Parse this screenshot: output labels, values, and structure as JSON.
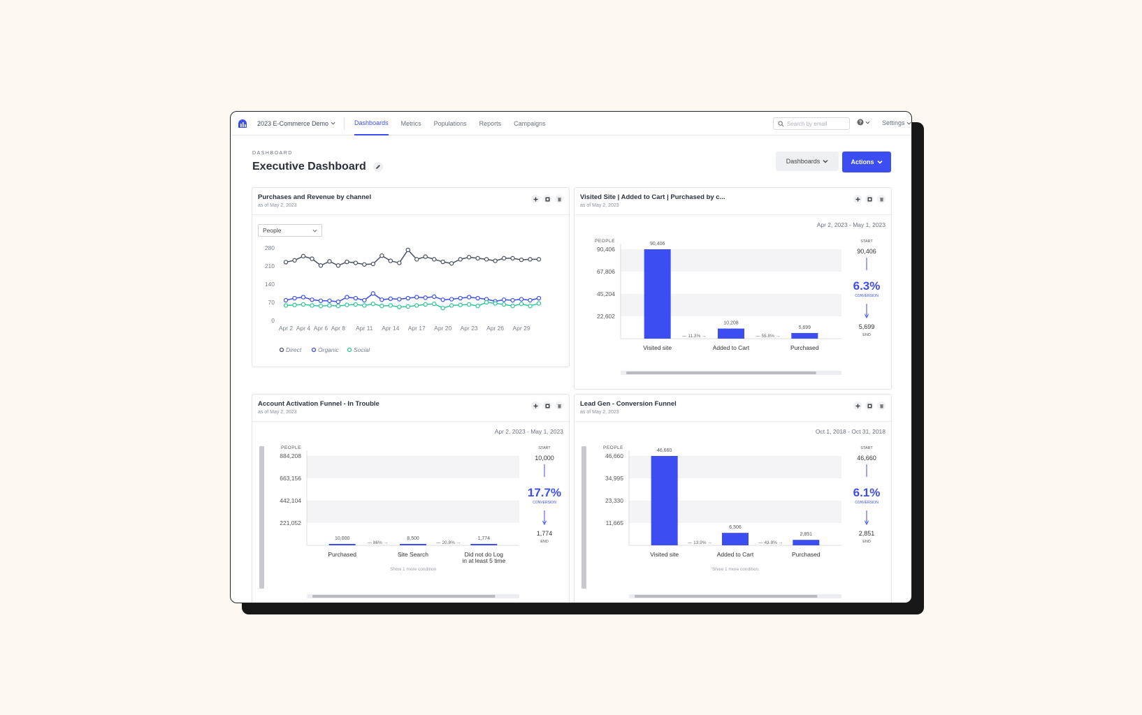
{
  "nav": {
    "workspace": "2023 E-Commerce Demo",
    "links": [
      {
        "label": "Dashboards",
        "active": true
      },
      {
        "label": "Metrics",
        "active": false
      },
      {
        "label": "Populations",
        "active": false
      },
      {
        "label": "Reports",
        "active": false
      },
      {
        "label": "Campaigns",
        "active": false
      }
    ],
    "search_placeholder": "Search by email",
    "help_icon": "question-circle-icon",
    "settings_label": "Settings"
  },
  "header": {
    "breadcrumb": "DASHBOARD",
    "title": "Executive Dashboard",
    "dashboards_button": "Dashboards",
    "actions_button": "Actions"
  },
  "colors": {
    "accent": "#3c4ef2",
    "direct": "#4a5060",
    "organic": "#3b4ef0",
    "social": "#2dc79a"
  },
  "cards": {
    "revenue": {
      "title": "Purchases and Revenue by channel",
      "subtitle": "as of May 2, 2023",
      "select": "People"
    },
    "visited": {
      "title": "Visited Site | Added to Cart | Purchased by c...",
      "subtitle": "as of May 2, 2023",
      "date_range": "Apr 2, 2023 - May 1, 2023",
      "people_label": "PEOPLE",
      "start_label": "START",
      "start_value": "90,406",
      "conversion": "6.3%",
      "conversion_label": "CONVERSION",
      "end_value": "5,699",
      "end_label": "END"
    },
    "activation": {
      "title": "Account Activation Funnel - In Trouble",
      "subtitle": "as of May 2, 2023",
      "date_range": "Apr 2, 2023 - May 1, 2023",
      "people_label": "PEOPLE",
      "start_label": "START",
      "start_value": "10,000",
      "conversion": "17.7%",
      "conversion_label": "CONVERSION",
      "end_value": "1,774",
      "end_label": "END",
      "footnote": "Show 1 more condition"
    },
    "leadgen": {
      "title": "Lead Gen - Conversion Funnel",
      "subtitle": "as of May 2, 2023",
      "date_range": "Oct 1, 2018 - Oct 31, 2018",
      "people_label": "PEOPLE",
      "start_label": "START",
      "start_value": "46,660",
      "conversion": "6.1%",
      "conversion_label": "CONVERSION",
      "end_value": "2,851",
      "end_label": "END",
      "footnote": "Show 1 more condition"
    }
  },
  "chart_data": [
    {
      "type": "line",
      "x": [
        "Apr 2",
        "Apr 3",
        "Apr 4",
        "Apr 5",
        "Apr 6",
        "Apr 7",
        "Apr 8",
        "Apr 9",
        "Apr 10",
        "Apr 11",
        "Apr 12",
        "Apr 13",
        "Apr 14",
        "Apr 15",
        "Apr 16",
        "Apr 17",
        "Apr 18",
        "Apr 19",
        "Apr 20",
        "Apr 21",
        "Apr 22",
        "Apr 23",
        "Apr 24",
        "Apr 25",
        "Apr 26",
        "Apr 27",
        "Apr 28",
        "Apr 29",
        "Apr 30",
        "May 1"
      ],
      "x_tick_labels": [
        "Apr 2",
        "Apr 4",
        "Apr 6",
        "Apr 8",
        "Apr 11",
        "Apr 14",
        "Apr 17",
        "Apr 20",
        "Apr 23",
        "Apr 26",
        "Apr 29"
      ],
      "x_tick_days": [
        2,
        4,
        6,
        8,
        11,
        14,
        17,
        20,
        23,
        26,
        29
      ],
      "y_ticks": [
        "280",
        "210",
        "140",
        "70",
        "0"
      ],
      "ylim": [
        0,
        280
      ],
      "series": [
        {
          "name": "Direct",
          "values": [
            225,
            232,
            248,
            238,
            212,
            228,
            212,
            226,
            222,
            216,
            218,
            250,
            230,
            222,
            272,
            236,
            246,
            236,
            226,
            220,
            236,
            244,
            240,
            236,
            230,
            240,
            240,
            234,
            236,
            236
          ]
        },
        {
          "name": "Organic",
          "values": [
            78,
            86,
            90,
            80,
            76,
            76,
            72,
            90,
            86,
            78,
            104,
            80,
            84,
            82,
            86,
            90,
            88,
            92,
            80,
            82,
            86,
            90,
            86,
            82,
            74,
            80,
            78,
            82,
            78,
            86
          ]
        },
        {
          "name": "Social",
          "values": [
            58,
            60,
            62,
            58,
            56,
            58,
            56,
            60,
            62,
            58,
            64,
            56,
            58,
            52,
            54,
            58,
            62,
            64,
            48,
            58,
            60,
            62,
            56,
            70,
            66,
            62,
            56,
            64,
            56,
            66
          ]
        }
      ],
      "legend": "bottom-left",
      "grid": false
    },
    {
      "type": "bar",
      "categories": [
        "Visited site",
        "Added to Cart",
        "Purchased"
      ],
      "values": [
        90406,
        10208,
        5699
      ],
      "value_labels": [
        "90,406",
        "10,208",
        "5,699"
      ],
      "step_conversions": [
        "11.3%",
        "55.8%"
      ],
      "y_ticks": [
        "90,406",
        "67,806",
        "45,204",
        "22,602"
      ],
      "ylim": [
        0,
        90406
      ]
    },
    {
      "type": "bar",
      "categories": [
        "Purchased",
        "Site Search",
        "Did not do Log in at least 5 time"
      ],
      "values": [
        10000,
        8500,
        1774
      ],
      "value_labels": [
        "10,000",
        "8,500",
        "1,774"
      ],
      "step_conversions": [
        "86%",
        "20.8%"
      ],
      "y_ticks": [
        "884,208",
        "663,156",
        "442,104",
        "221,052"
      ],
      "ylim": [
        0,
        884208
      ]
    },
    {
      "type": "bar",
      "categories": [
        "Visited site",
        "Added to Cart",
        "Purchased"
      ],
      "values": [
        46660,
        6506,
        2851
      ],
      "value_labels": [
        "46,660",
        "6,506",
        "2,851"
      ],
      "step_conversions": [
        "13.9%",
        "43.8%"
      ],
      "y_ticks": [
        "46,660",
        "34,995",
        "23,330",
        "11,665"
      ],
      "ylim": [
        0,
        46660
      ]
    }
  ]
}
